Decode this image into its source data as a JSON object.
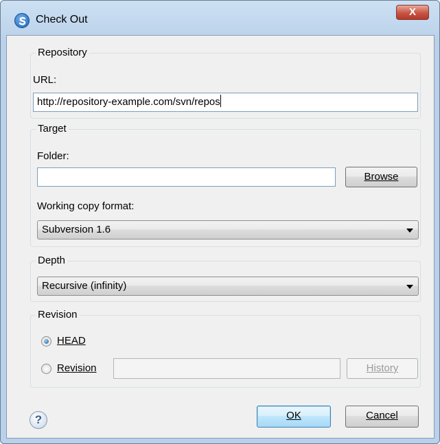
{
  "window": {
    "title": "Check Out",
    "close_label": "X"
  },
  "repository": {
    "legend": "Repository",
    "url_label": "URL:",
    "url_value": "http://repository-example.com/svn/repos"
  },
  "target": {
    "legend": "Target",
    "folder_label": "Folder:",
    "folder_value": "",
    "browse_label": "Browse",
    "format_label": "Working copy format:",
    "format_selected": "Subversion 1.6"
  },
  "depth": {
    "legend": "Depth",
    "selected": "Recursive (infinity)"
  },
  "revision": {
    "legend": "Revision",
    "head_label": "HEAD",
    "revision_label": "Revision",
    "revision_value": "",
    "history_label": "History",
    "selected": "HEAD"
  },
  "footer": {
    "help_glyph": "?",
    "ok_label": "OK",
    "cancel_label": "Cancel"
  },
  "icons": [
    "app-icon",
    "close-icon",
    "help-icon",
    "dropdown-arrow-icon"
  ]
}
